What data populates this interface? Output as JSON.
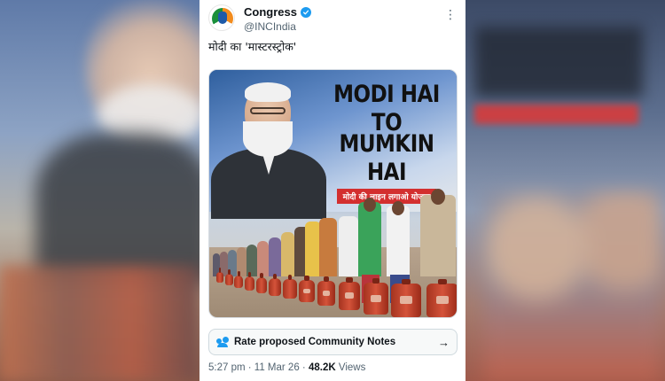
{
  "account": {
    "name": "Congress",
    "handle": "@INCIndia"
  },
  "tweet": {
    "text": "मोदी का 'मास्टरस्ट्रोक'"
  },
  "media": {
    "headline_line1": "MODI HAI TO",
    "headline_line2": "MUMKIN HAI",
    "banner": "मोदी की लाइन लगाओ योजना"
  },
  "community_notes": {
    "label": "Rate proposed Community Notes"
  },
  "meta": {
    "time": "5:27 pm",
    "separator1": " · ",
    "date": "11 Mar 26",
    "separator2": " · ",
    "views_count": "48.2K",
    "views_label": " Views"
  },
  "colors": {
    "accent": "#1d9bf0",
    "banner_red": "#d32f2f",
    "text_primary": "#0f1419",
    "text_secondary": "#536471"
  },
  "icons": {
    "more": "more-dots-icon",
    "verified": "verified-badge-icon",
    "notes": "community-notes-icon",
    "arrow": "arrow-right-icon"
  }
}
